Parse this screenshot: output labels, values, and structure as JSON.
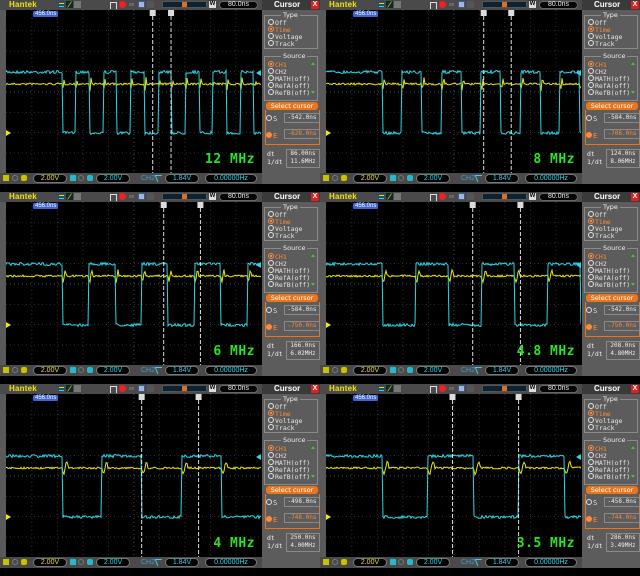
{
  "header": {
    "brand": "Hantek",
    "timebase": "80.0ns",
    "cursor_title": "Cursor",
    "close_label": "X",
    "trigger_position": "456.0ns",
    "memory_window_label": "W"
  },
  "cursor_panel": {
    "type_group_label": "Type",
    "type_options": [
      "Off",
      "Time",
      "Voltage",
      "Track"
    ],
    "type_selected": "Time",
    "source_group_label": "Source",
    "source_options": [
      "CH1",
      "CH2",
      "MATH(off)",
      "RefA(off)",
      "RefB(off)"
    ],
    "source_selected": "CH1",
    "select_cursor_label": "Select cursor",
    "s_label": "S",
    "e_label": "E",
    "dt_label": "dt",
    "inv_dt_label": "1/dt"
  },
  "status_bar": {
    "ch1_scale": "2.00V",
    "ch2_scale": "2.00V",
    "trigger_source": "CH2",
    "trigger_level": "1.84V",
    "frequency_readout": "0.00000Hz"
  },
  "colors": {
    "ch1": "#f2e600",
    "ch2": "#2cd6e6",
    "annotation": "#29e329",
    "selected": "#ff8a3a",
    "close": "#e02020"
  },
  "panels": [
    {
      "annotation": "12 MHz",
      "cursor_s": "-542.0ns",
      "cursor_e": "-628.0ns",
      "dt": "86.00ns",
      "inv_dt": "11.6MHz",
      "period_ns": 86,
      "bursts": 8,
      "cursor_s_div": 6.9,
      "cursor_e_div": 7.9
    },
    {
      "annotation": "8 MHz",
      "cursor_s": "-584.0ns",
      "cursor_e": "-708.0ns",
      "dt": "124.0ns",
      "inv_dt": "8.06MHz",
      "period_ns": 124,
      "bursts": 8,
      "cursor_s_div": 7.5,
      "cursor_e_div": 9.0
    },
    {
      "annotation": "6 MHz",
      "cursor_s": "-584.0ns",
      "cursor_e": "-750.0ns",
      "dt": "166.0ns",
      "inv_dt": "6.02MHz",
      "period_ns": 166,
      "bursts": 8,
      "cursor_s_div": 7.5,
      "cursor_e_div": 9.5
    },
    {
      "annotation": "4.8 MHz",
      "cursor_s": "-542.0ns",
      "cursor_e": "-750.0ns",
      "dt": "208.0ns",
      "inv_dt": "4.80MHz",
      "period_ns": 208,
      "bursts": 8,
      "cursor_s_div": 6.9,
      "cursor_e_div": 9.5
    },
    {
      "annotation": "4 MHz",
      "cursor_s": "-498.0ns",
      "cursor_e": "-748.0ns",
      "dt": "250.0ns",
      "inv_dt": "4.00MHz",
      "period_ns": 250,
      "bursts": 8,
      "cursor_s_div": 6.3,
      "cursor_e_div": 9.4
    },
    {
      "annotation": "3.5 MHz",
      "cursor_s": "-458.0ns",
      "cursor_e": "-744.0ns",
      "dt": "286.0ns",
      "inv_dt": "3.49MHz",
      "period_ns": 286,
      "bursts": 8,
      "cursor_s_div": 5.8,
      "cursor_e_div": 9.4
    }
  ]
}
